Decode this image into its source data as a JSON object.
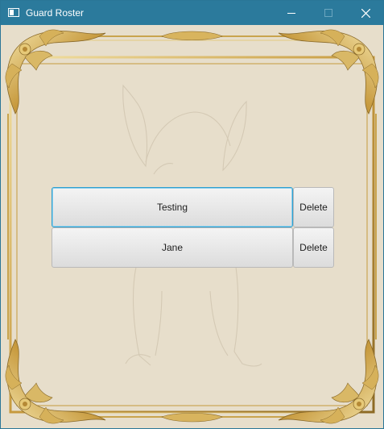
{
  "window": {
    "title": "Guard Roster",
    "controls": {
      "minimize_icon": "minimize-icon",
      "maximize_icon": "maximize-icon",
      "close_icon": "close-icon"
    }
  },
  "roster": {
    "entries": [
      {
        "name": "Testing",
        "delete_label": "Delete",
        "focused": true
      },
      {
        "name": "Jane",
        "delete_label": "Delete",
        "focused": false
      }
    ]
  },
  "colors": {
    "titlebar": "#2b7a9c",
    "background": "#e7decb",
    "gold": "#c9a44e",
    "focus": "#2f9fd0"
  }
}
